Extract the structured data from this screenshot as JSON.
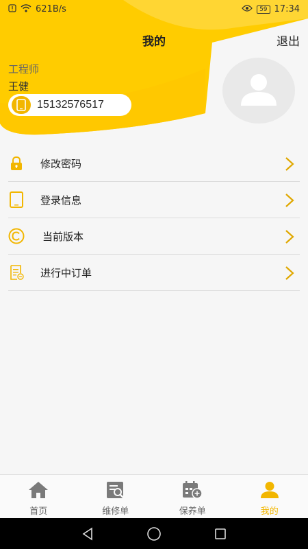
{
  "status_bar": {
    "network_speed": "621B/s",
    "battery": "59",
    "time": "17:34"
  },
  "header": {
    "title": "我的",
    "logout_label": "退出"
  },
  "profile": {
    "role": "工程师",
    "name": "王健",
    "phone": "15132576517"
  },
  "menu": {
    "items": [
      {
        "label": "修改密码",
        "icon": "lock-icon"
      },
      {
        "label": "登录信息",
        "icon": "tablet-icon"
      },
      {
        "label": "当前版本",
        "icon": "copyright-icon"
      },
      {
        "label": "进行中订单",
        "icon": "order-list-icon"
      }
    ]
  },
  "tabs": [
    {
      "label": "首页",
      "icon": "home-icon"
    },
    {
      "label": "维修单",
      "icon": "repair-order-icon"
    },
    {
      "label": "保养单",
      "icon": "maintenance-order-icon"
    },
    {
      "label": "我的",
      "icon": "user-icon",
      "active": true
    }
  ],
  "colors": {
    "accent": "#f2b600",
    "header_yellow": "#ffcc00",
    "header_light": "#ffdb4d"
  }
}
